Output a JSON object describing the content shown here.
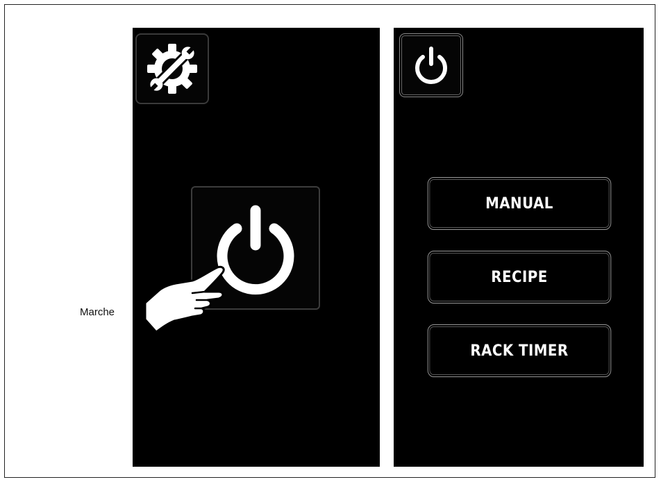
{
  "caption": "Marche",
  "left_screen": {
    "settings_icon": "settings-wrench-gear-icon",
    "power_icon": "power-icon",
    "hand_icon": "pointing-hand-icon"
  },
  "right_screen": {
    "power_icon": "power-icon",
    "buttons": [
      {
        "label": "MANUAL"
      },
      {
        "label": "RECIPE"
      },
      {
        "label": "RACK TIMER"
      }
    ]
  },
  "colors": {
    "screen_bg": "#000000",
    "text": "#ffffff",
    "border": "#9a9a9a"
  }
}
